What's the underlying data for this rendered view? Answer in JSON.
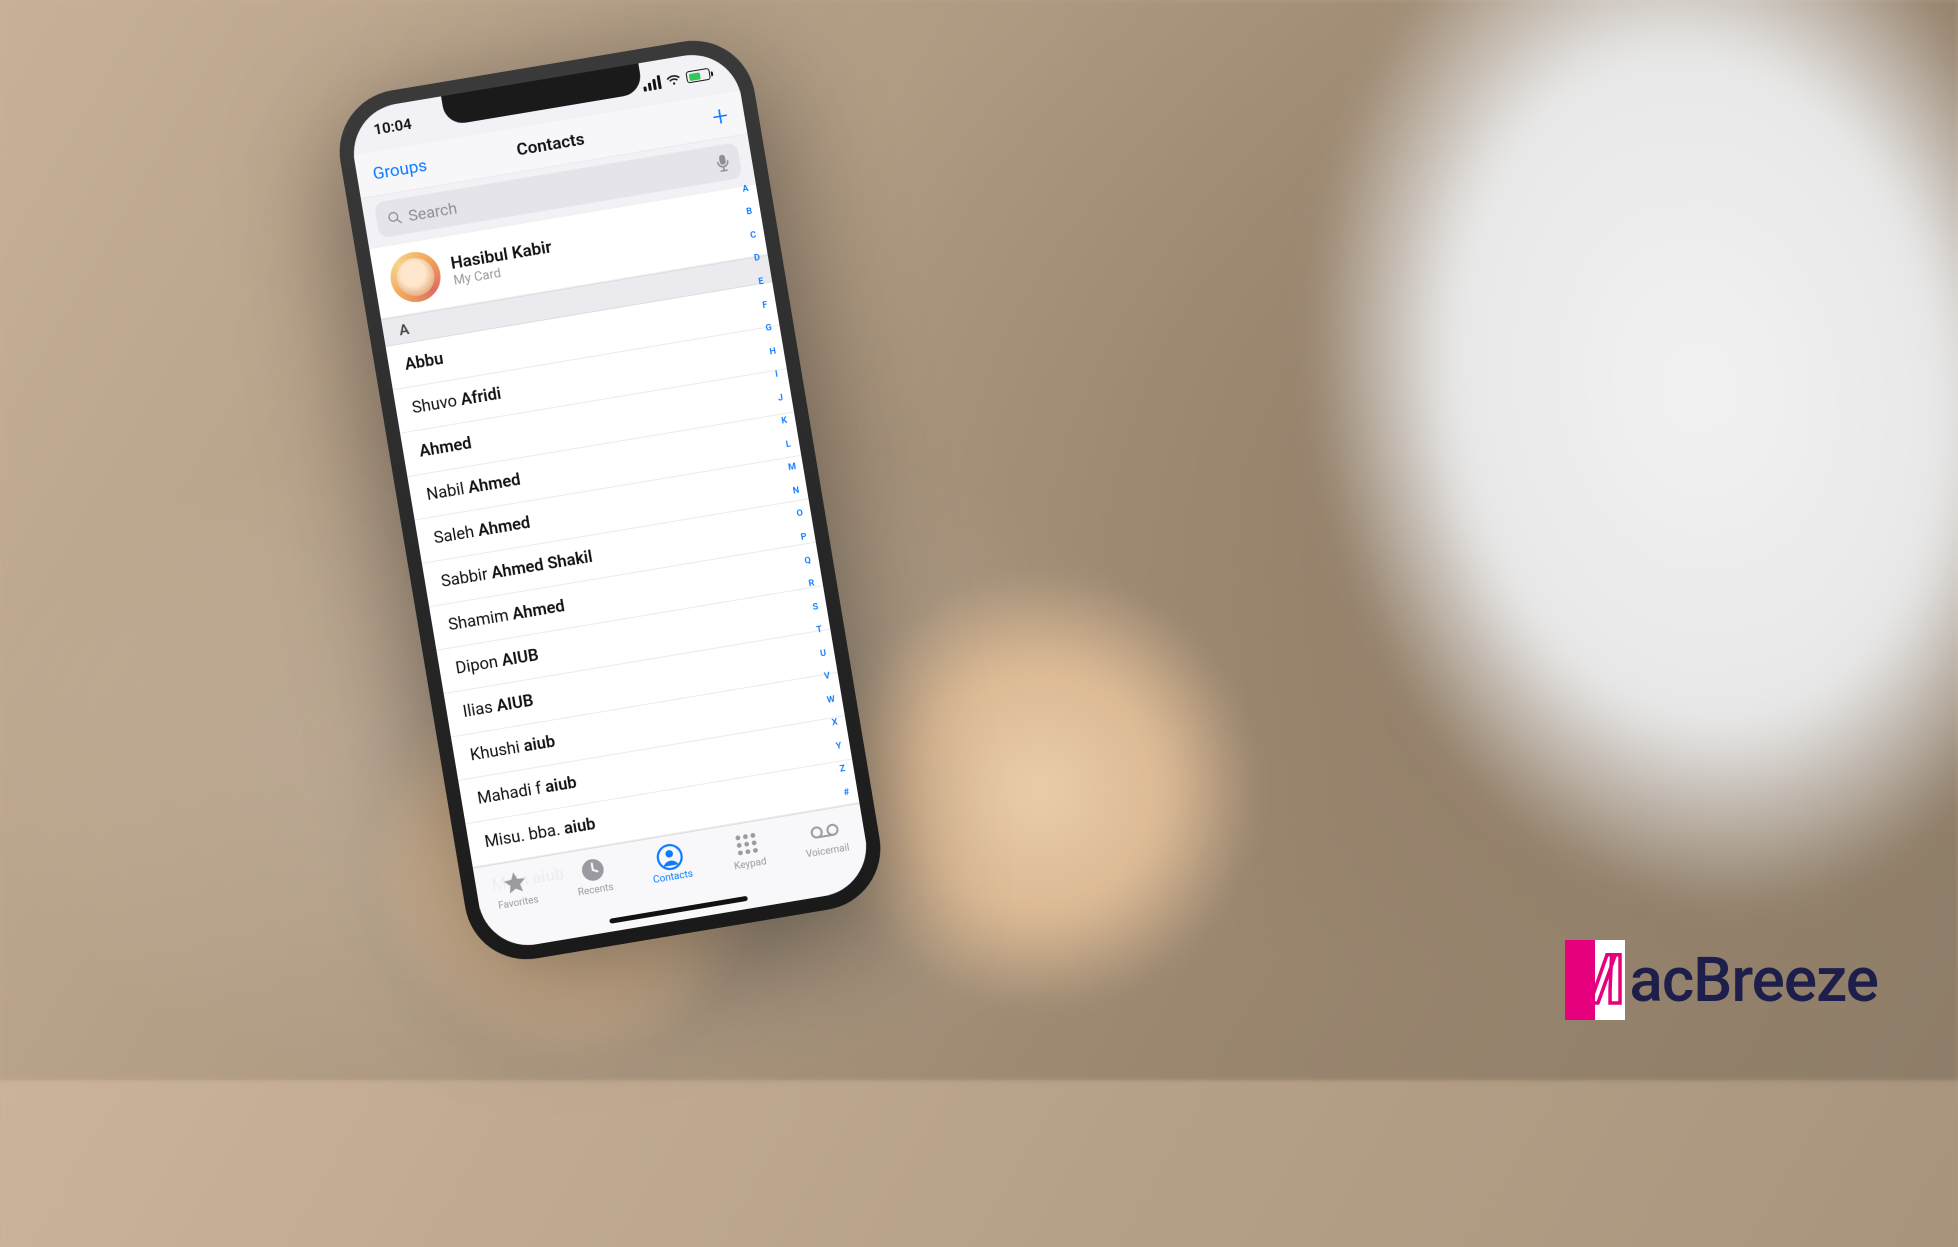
{
  "statusbar": {
    "time": "10:04"
  },
  "nav": {
    "title": "Contacts",
    "groups": "Groups",
    "add": "+"
  },
  "search": {
    "placeholder": "Search"
  },
  "mycard": {
    "name": "Hasibul Kabir",
    "sub": "My Card"
  },
  "section": {
    "letter": "A"
  },
  "contacts": [
    {
      "first": "",
      "bold": "Abbu"
    },
    {
      "first": "Shuvo ",
      "bold": "Afridi"
    },
    {
      "first": "",
      "bold": "Ahmed"
    },
    {
      "first": "Nabil ",
      "bold": "Ahmed"
    },
    {
      "first": "Saleh ",
      "bold": "Ahmed"
    },
    {
      "first": "Sabbir ",
      "bold": "Ahmed Shakil"
    },
    {
      "first": "Shamim ",
      "bold": "Ahmed"
    },
    {
      "first": "Dipon ",
      "bold": "AIUB"
    },
    {
      "first": "Ilias ",
      "bold": "AIUB"
    },
    {
      "first": "Khushi ",
      "bold": "aiub"
    },
    {
      "first": "Mahadi f ",
      "bold": "aiub"
    },
    {
      "first": "Misu. bba. ",
      "bold": "aiub"
    },
    {
      "first": "Moin ",
      "bold": "aiub"
    }
  ],
  "index": [
    "A",
    "B",
    "C",
    "D",
    "E",
    "F",
    "G",
    "H",
    "I",
    "J",
    "K",
    "L",
    "M",
    "N",
    "O",
    "P",
    "Q",
    "R",
    "S",
    "T",
    "U",
    "V",
    "W",
    "X",
    "Y",
    "Z",
    "#"
  ],
  "tabs": {
    "favorites": "Favorites",
    "recents": "Recents",
    "contacts": "Contacts",
    "keypad": "Keypad",
    "voicemail": "Voicemail"
  },
  "watermark": {
    "m": "M",
    "rest": "acBreeze"
  }
}
